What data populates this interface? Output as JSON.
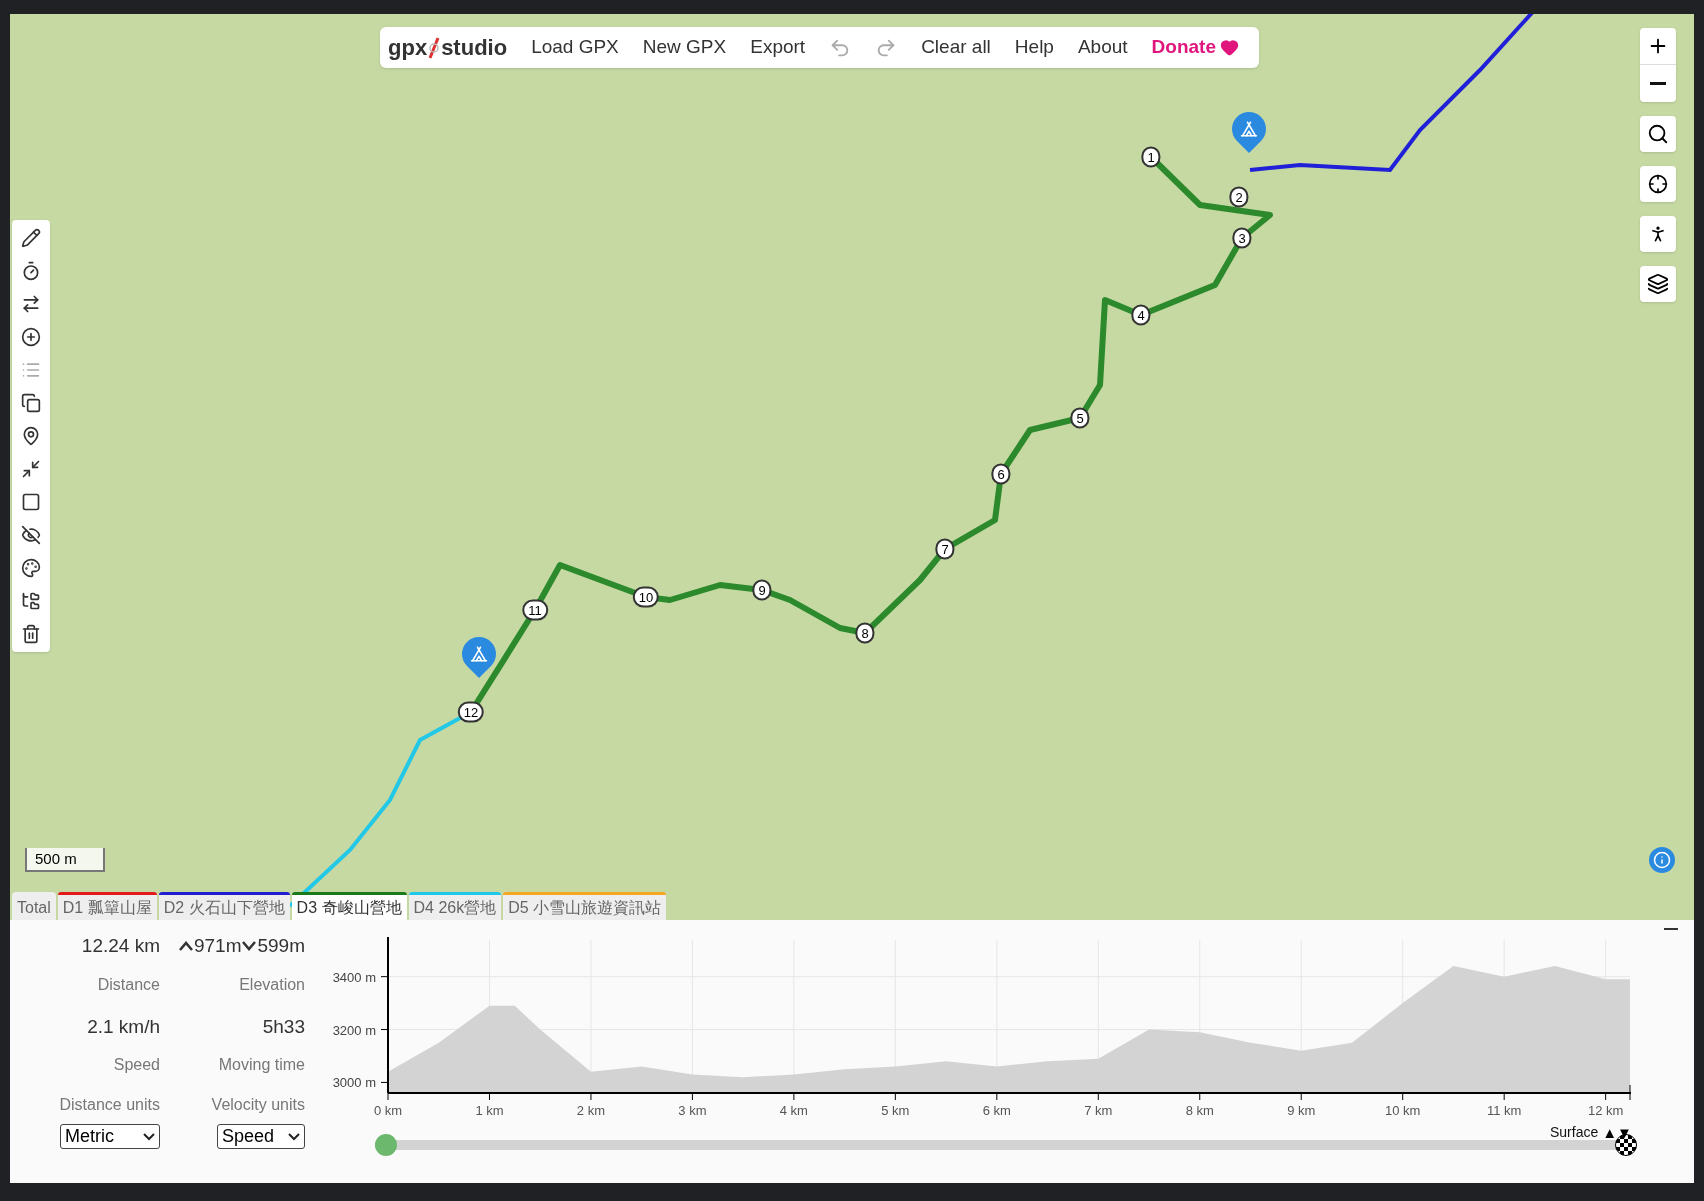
{
  "menu": {
    "logo": [
      "gpx",
      "studio"
    ],
    "items": [
      {
        "kind": "text",
        "label": "Load GPX"
      },
      {
        "kind": "text",
        "label": "New GPX"
      },
      {
        "kind": "text",
        "label": "Export"
      },
      {
        "kind": "undo",
        "disabled": true
      },
      {
        "kind": "redo",
        "disabled": true
      },
      {
        "kind": "text",
        "label": "Clear all"
      },
      {
        "kind": "text",
        "label": "Help"
      },
      {
        "kind": "text",
        "label": "About"
      },
      {
        "kind": "donate",
        "label": "Donate"
      }
    ]
  },
  "toolbar": [
    {
      "kind": "pencil",
      "disabled": false
    },
    {
      "kind": "timer",
      "disabled": false
    },
    {
      "kind": "reverse",
      "disabled": false
    },
    {
      "kind": "add",
      "disabled": false
    },
    {
      "kind": "list",
      "disabled": true
    },
    {
      "kind": "copy",
      "disabled": false
    },
    {
      "kind": "pin",
      "disabled": false
    },
    {
      "kind": "shrink",
      "disabled": false
    },
    {
      "kind": "crop",
      "disabled": false
    },
    {
      "kind": "hide",
      "disabled": false
    },
    {
      "kind": "palette",
      "disabled": false
    },
    {
      "kind": "tree",
      "disabled": false
    },
    {
      "kind": "trash",
      "disabled": false
    }
  ],
  "waypoints": [
    "1",
    "2",
    "3",
    "4",
    "5",
    "6",
    "7",
    "8",
    "9",
    "10",
    "11",
    "12"
  ],
  "scale": "500 m",
  "tabs": [
    {
      "label": "Total",
      "selected": false
    },
    {
      "label": "D1 瓢簞山屋",
      "selected": false,
      "color": "#e31a1c"
    },
    {
      "label": "D2 火石山下營地",
      "selected": false,
      "color": "#1f1fd0"
    },
    {
      "label": "D3 奇峻山營地",
      "selected": true,
      "color": "#1a7a1a"
    },
    {
      "label": "D4 26k營地",
      "selected": false,
      "color": "#1fc8e8"
    },
    {
      "label": "D5 小雪山旅遊資訊站",
      "selected": false,
      "color": "#f5a623"
    }
  ],
  "stats": [
    {
      "value": "12.24 km",
      "label": "Distance"
    },
    {
      "up": "971m",
      "down": "599m",
      "label": "Elevation"
    },
    {
      "value": "2.1 km/h",
      "label": "Speed"
    },
    {
      "value": "5h33",
      "label": "Moving time"
    }
  ],
  "units": [
    {
      "label": "Distance units",
      "value": "Metric"
    },
    {
      "label": "Velocity units",
      "value": "Speed"
    }
  ],
  "profile": {
    "chart_data": {
      "type": "area",
      "x": [
        0,
        0.5,
        1,
        1.25,
        1.5,
        2,
        2.5,
        3,
        3.5,
        4,
        4.5,
        5,
        5.5,
        6,
        6.5,
        7,
        7.5,
        8,
        8.5,
        9,
        9.5,
        10,
        10.5,
        11,
        11.5,
        12,
        12.24
      ],
      "grid": true,
      "series": [
        {
          "color": "#d3d3d3",
          "values": [
            3040,
            3150,
            3290,
            3290,
            3200,
            3040,
            3060,
            3030,
            3020,
            3030,
            3050,
            3060,
            3080,
            3060,
            3080,
            3090,
            3200,
            3190,
            3150,
            3120,
            3150,
            3300,
            3440,
            3400,
            3440,
            3390,
            3390
          ]
        }
      ],
      "ylim": [
        2960,
        3550
      ],
      "xlim": [
        0,
        12.24
      ],
      "xticks": [
        {
          "value": 0,
          "label": "0 km"
        },
        {
          "value": 1,
          "label": "1 km"
        },
        {
          "value": 2,
          "label": "2 km"
        },
        {
          "value": 3,
          "label": "3 km"
        },
        {
          "value": 4,
          "label": "4 km"
        },
        {
          "value": 5,
          "label": "5 km"
        },
        {
          "value": 6,
          "label": "6 km"
        },
        {
          "value": 7,
          "label": "7 km"
        },
        {
          "value": 8,
          "label": "8 km"
        },
        {
          "value": 9,
          "label": "9 km"
        },
        {
          "value": 10,
          "label": "10 km"
        },
        {
          "value": 11,
          "label": "11 km"
        },
        {
          "value": 12,
          "label": "12 km"
        }
      ],
      "yticks": [
        {
          "value": 3000,
          "label": "3000 m"
        },
        {
          "value": 3200,
          "label": "3200 m"
        },
        {
          "value": 3400,
          "label": "3400 m"
        }
      ]
    },
    "selection": {
      "level": 1
    },
    "surface": "Surface",
    "sort_arrows": "▲▼"
  }
}
